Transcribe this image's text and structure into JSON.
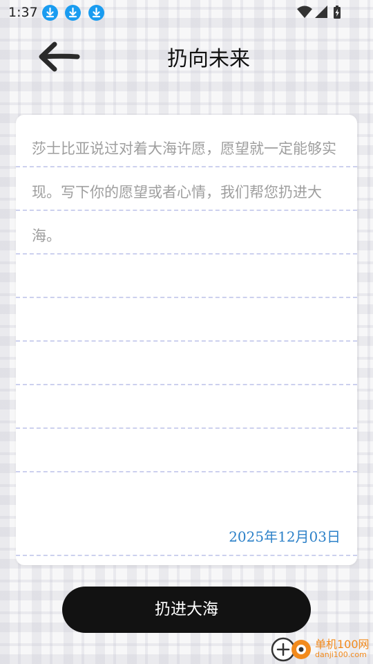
{
  "status_bar": {
    "time": "1:37",
    "icons": [
      "download-icon",
      "download-icon",
      "download-icon",
      "wifi-icon",
      "signal-icon",
      "battery-charging-icon"
    ]
  },
  "header": {
    "back_icon": "arrow-left-icon",
    "title": "扔向未来"
  },
  "note": {
    "placeholder_lines": [
      "莎士比亚说过对着大海许愿，愿望就一定能够实",
      "现。写下你的愿望或者心情，我们帮您扔进大",
      "海。"
    ],
    "date": "2025年12月03日"
  },
  "action": {
    "throw_label": "扔进大海"
  },
  "watermark": {
    "name": "单机100网",
    "url": "danji100.com"
  },
  "colors": {
    "button_bg": "#121212",
    "date_text": "#2b80c8",
    "placeholder_text": "#9e9e9e",
    "rule_line": "#ccd0ee",
    "download_badge": "#1a9cf0"
  }
}
